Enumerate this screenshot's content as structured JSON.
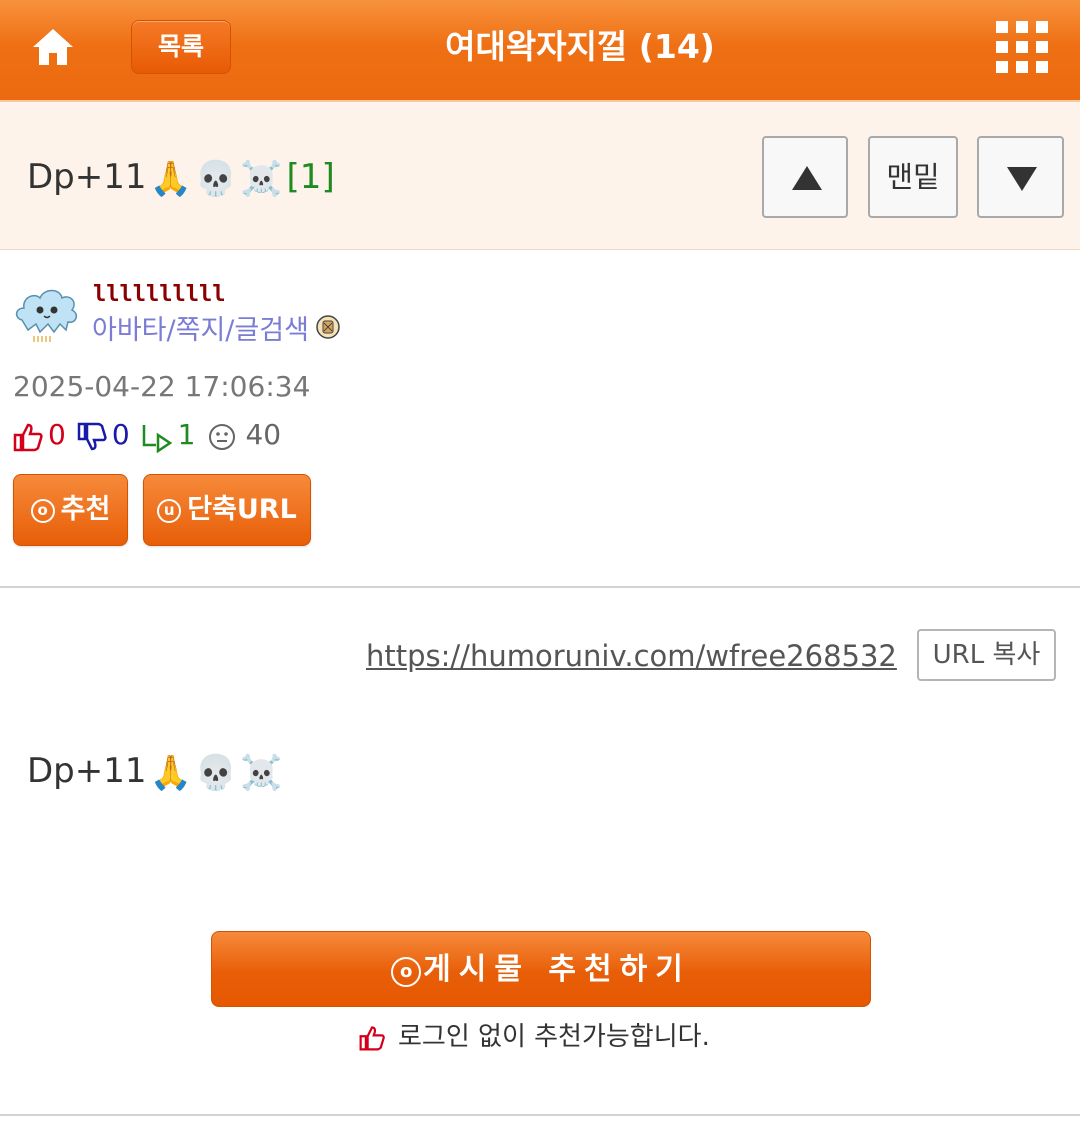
{
  "header": {
    "list_label": "목록",
    "board_title": "여대왁자지껄 (14)"
  },
  "post": {
    "subject": "Dp+11",
    "subject_emojis": [
      "🙏",
      "💀",
      "☠️"
    ],
    "comment_count": "[1]",
    "nav_bottom_label": "맨밑",
    "author": {
      "nickname": "llllllllll",
      "links": "아바타/쪽지/글검색"
    },
    "datetime": "2025-04-22 17:06:34",
    "stats": {
      "likes": "0",
      "dislikes": "0",
      "shares": "1",
      "views": "40"
    },
    "recommend_label": "추천",
    "short_url_label": "단축URL",
    "url": "https://humoruniv.com/wfree268532",
    "url_copy_label": "URL 복사",
    "body": "Dp+11",
    "body_emojis": [
      "🙏",
      "💀",
      "☠️"
    ],
    "big_recommend_label": "게시물  추천하기",
    "recommend_note": "로그인 없이 추천가능합니다."
  },
  "colors": {
    "accent": "#ef7014",
    "comment_count": "#1f8a1f",
    "user_links": "#7b7cd6",
    "like": "#d4001a",
    "dislike": "#1a1aa8",
    "share": "#1f8a1f"
  },
  "icons": [
    "home-icon",
    "grid-menu-icon",
    "up-arrow-icon",
    "down-arrow-icon",
    "thumbs-up-icon",
    "thumbs-down-icon",
    "share-arrow-icon",
    "view-face-icon",
    "badge-icon"
  ]
}
